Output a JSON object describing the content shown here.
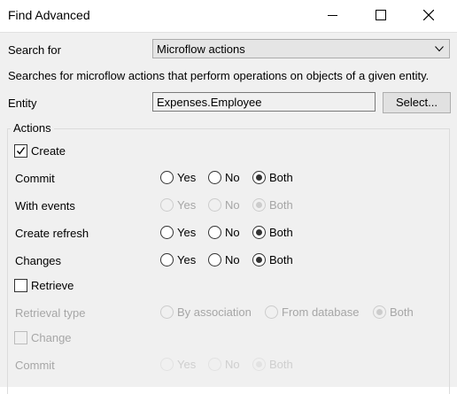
{
  "window": {
    "title": "Find Advanced"
  },
  "search_for": {
    "label": "Search for",
    "value": "Microflow actions"
  },
  "description": "Searches for microflow actions that perform operations on objects of a given entity.",
  "entity": {
    "label": "Entity",
    "value": "Expenses.Employee",
    "select_label": "Select..."
  },
  "actions": {
    "title": "Actions",
    "create_label": "Create",
    "create_checked": true,
    "rows": [
      {
        "label": "Commit",
        "yes": "Yes",
        "no": "No",
        "both": "Both",
        "selected": "Both",
        "enabled": true
      },
      {
        "label": "With events",
        "yes": "Yes",
        "no": "No",
        "both": "Both",
        "selected": "Both",
        "enabled": false
      },
      {
        "label": "Create refresh",
        "yes": "Yes",
        "no": "No",
        "both": "Both",
        "selected": "Both",
        "enabled": true
      },
      {
        "label": "Changes",
        "yes": "Yes",
        "no": "No",
        "both": "Both",
        "selected": "Both",
        "enabled": true
      }
    ],
    "retrieve_label": "Retrieve",
    "retrieve_checked": false,
    "retrieval_type": {
      "label": "Retrieval type",
      "by_association": "By association",
      "from_database": "From database",
      "both": "Both",
      "selected": "Both",
      "enabled": false
    },
    "change_label": "Change",
    "change_checked": false,
    "commit2": {
      "label": "Commit",
      "yes": "Yes",
      "no": "No",
      "both": "Both",
      "selected": "Both",
      "enabled": false
    }
  }
}
